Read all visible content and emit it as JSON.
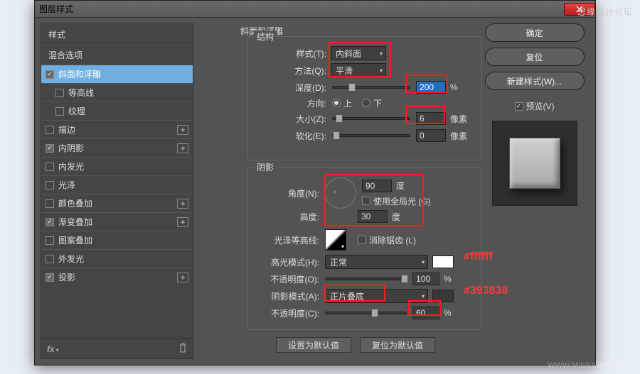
{
  "watermark_top": "思缘设计论坛",
  "watermark_bottom": "WWW.MISSYUAN.COM",
  "dialog": {
    "title": "图层样式"
  },
  "sidebar": {
    "header": "样式",
    "blend": "混合选项",
    "items": [
      {
        "label": "斜面和浮雕",
        "checked": true,
        "selected": true,
        "indent": false,
        "plus": false
      },
      {
        "label": "等高线",
        "checked": false,
        "selected": false,
        "indent": true,
        "plus": false
      },
      {
        "label": "纹理",
        "checked": false,
        "selected": false,
        "indent": true,
        "plus": false
      },
      {
        "label": "描边",
        "checked": false,
        "selected": false,
        "indent": false,
        "plus": true
      },
      {
        "label": "内阴影",
        "checked": true,
        "selected": false,
        "indent": false,
        "plus": true
      },
      {
        "label": "内发光",
        "checked": false,
        "selected": false,
        "indent": false,
        "plus": false
      },
      {
        "label": "光泽",
        "checked": false,
        "selected": false,
        "indent": false,
        "plus": false
      },
      {
        "label": "颜色叠加",
        "checked": false,
        "selected": false,
        "indent": false,
        "plus": true
      },
      {
        "label": "渐变叠加",
        "checked": true,
        "selected": false,
        "indent": false,
        "plus": true
      },
      {
        "label": "图案叠加",
        "checked": false,
        "selected": false,
        "indent": false,
        "plus": false
      },
      {
        "label": "外发光",
        "checked": false,
        "selected": false,
        "indent": false,
        "plus": false
      },
      {
        "label": "投影",
        "checked": true,
        "selected": false,
        "indent": false,
        "plus": true
      }
    ]
  },
  "main": {
    "title": "斜面和浮雕",
    "structure": {
      "legend": "结构",
      "style_lbl": "样式(T):",
      "style_val": "内斜面",
      "method_lbl": "方法(Q):",
      "method_val": "平滑",
      "depth_lbl": "深度(D):",
      "depth_val": "200",
      "depth_unit": "%",
      "direction_lbl": "方向:",
      "up": "上",
      "down": "下",
      "size_lbl": "大小(Z):",
      "size_val": "6",
      "size_unit": "像素",
      "soften_lbl": "软化(E):",
      "soften_val": "0",
      "soften_unit": "像素"
    },
    "shading": {
      "legend": "阴影",
      "angle_lbl": "角度(N):",
      "angle_val": "90",
      "angle_unit": "度",
      "use_global": "使用全局光 (G)",
      "altitude_lbl": "高度:",
      "altitude_val": "30",
      "altitude_unit": "度",
      "gloss_lbl": "光泽等高线:",
      "antialias": "消除锯齿 (L)",
      "highlight_mode_lbl": "高光模式(H):",
      "highlight_mode_val": "正常",
      "highlight_opacity_lbl": "不透明度(O):",
      "highlight_opacity_val": "100",
      "pct": "%",
      "shadow_mode_lbl": "阴影模式(A):",
      "shadow_mode_val": "正片叠底",
      "shadow_opacity_lbl": "不透明度(C):",
      "shadow_opacity_val": "60"
    },
    "buttons": {
      "default": "设置为默认值",
      "reset": "复位为默认值"
    }
  },
  "right": {
    "ok": "确定",
    "cancel": "复位",
    "new_style": "新建样式(W)...",
    "preview": "预览(V)"
  },
  "annotations": {
    "hl": "#ffffff",
    "sh": "#393838"
  }
}
